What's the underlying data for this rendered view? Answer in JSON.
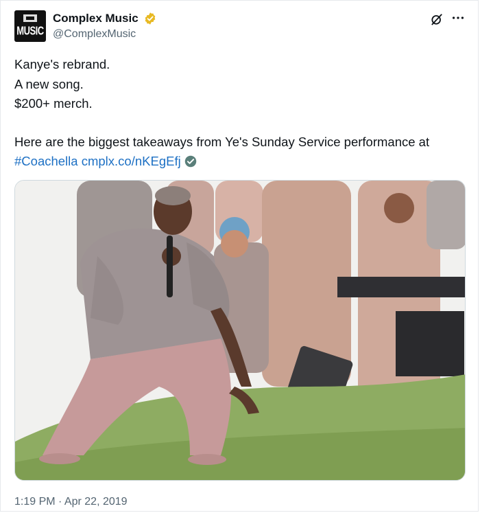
{
  "account": {
    "name": "Complex Music",
    "handle": "@ComplexMusic",
    "avatar_text": "MUSIC",
    "verified_color": "#e8b923"
  },
  "tweet": {
    "lines": [
      "Kanye's rebrand.",
      "A new song.",
      "$200+ merch."
    ],
    "body": "Here are the biggest takeaways from Ye's Sunday Service performance at",
    "hashtag": "#Coachella",
    "link": "cmplx.co/nKEgEfj",
    "link_color": "#1d70c4"
  },
  "media": {
    "image_alt": "Kanye West performing with microphone on a grassy hill with choir behind him"
  },
  "meta": {
    "timestamp": "1:19 PM · Apr 22, 2019"
  },
  "icons": {
    "verified": "verified-badge-icon",
    "grok": "grok-icon",
    "more": "more-icon",
    "link_check": "checkmark-icon"
  }
}
